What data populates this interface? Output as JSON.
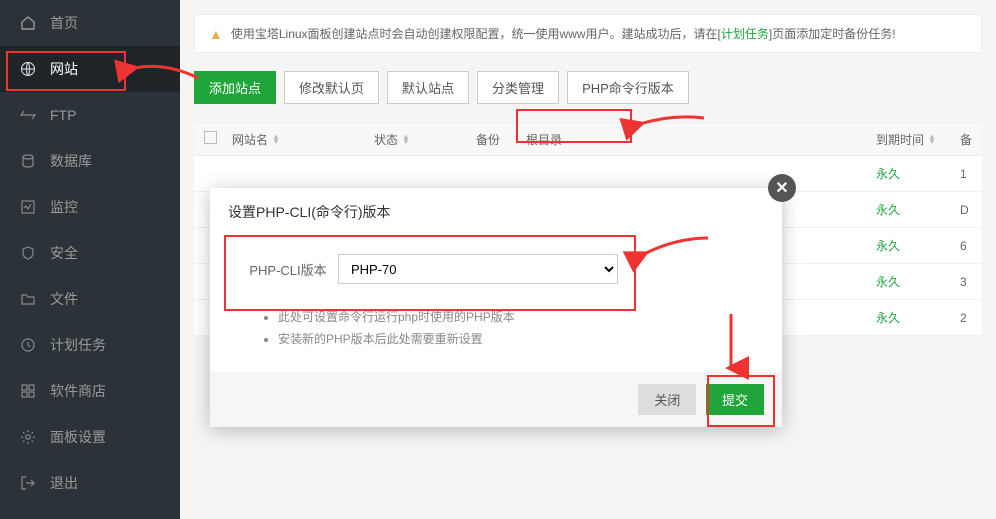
{
  "sidebar": {
    "items": [
      {
        "label": "首页",
        "icon": "home"
      },
      {
        "label": "网站",
        "icon": "globe"
      },
      {
        "label": "FTP",
        "icon": "ftp"
      },
      {
        "label": "数据库",
        "icon": "database"
      },
      {
        "label": "监控",
        "icon": "monitor"
      },
      {
        "label": "安全",
        "icon": "shield"
      },
      {
        "label": "文件",
        "icon": "folder"
      },
      {
        "label": "计划任务",
        "icon": "clock"
      },
      {
        "label": "软件商店",
        "icon": "apps"
      },
      {
        "label": "面板设置",
        "icon": "gear"
      },
      {
        "label": "退出",
        "icon": "exit"
      }
    ]
  },
  "alert": {
    "text_before": "使用宝塔Linux面板创建站点时会自动创建权限配置，统一使用www用户。建站成功后，请在[",
    "link": "计划任务",
    "text_after": "]页面添加定时备份任务!"
  },
  "toolbar": {
    "add_site": "添加站点",
    "edit_default": "修改默认页",
    "default_site": "默认站点",
    "category": "分类管理",
    "php_cli": "PHP命令行版本"
  },
  "table": {
    "headers": {
      "name": "网站名",
      "status": "状态",
      "backup": "备份",
      "root": "根目录",
      "expire": "到期时间",
      "last": "备"
    },
    "rows": [
      {
        "expire": "永久",
        "last": "1"
      },
      {
        "expire": "永久",
        "last": "D"
      },
      {
        "expire": "永久",
        "last": "6"
      },
      {
        "expire": "永久",
        "last": "3"
      },
      {
        "expire": "永久",
        "last": "2"
      }
    ]
  },
  "modal": {
    "title": "设置PHP-CLI(命令行)版本",
    "form_label": "PHP-CLI版本",
    "selected_option": "PHP-70",
    "tip1": "此处可设置命令行运行php时使用的PHP版本",
    "tip2": "安装新的PHP版本后此处需要重新设置",
    "cancel": "关闭",
    "submit": "提交"
  }
}
